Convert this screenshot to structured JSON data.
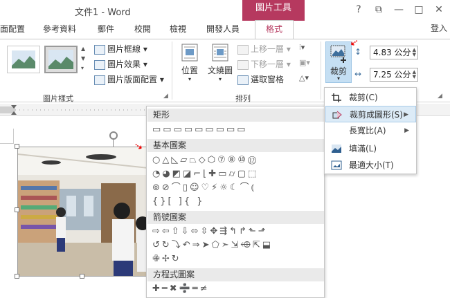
{
  "titlebar": {
    "doc_title": "文件1 - Word",
    "ctx_tools": "圖片工具",
    "help": "?",
    "restore_icon": "⧉",
    "minimize": "—",
    "maximize": "□",
    "close": "✕",
    "signin": "登入"
  },
  "tabs": [
    "面配置",
    "參考資料",
    "郵件",
    "校閱",
    "檢視",
    "開發人員"
  ],
  "active_tab": "格式",
  "ribbon": {
    "style_menu": [
      "圖片框線",
      "圖片效果",
      "圖片版面配置"
    ],
    "group_picture_styles": "圖片樣式",
    "position": "位置",
    "wrap_text": "文繞圖",
    "bring_forward": "上移一層",
    "send_backward": "下移一層",
    "selection_pane": "選取窗格",
    "group_arrange": "排列",
    "crop": "裁剪",
    "height": "4.83 公分",
    "width": "7.25 公分"
  },
  "shapes_gallery": {
    "categories": [
      "矩形",
      "基本圖案",
      "箭號圖案",
      "方程式圖案"
    ]
  },
  "crop_menu": {
    "items": [
      {
        "label": "裁剪(C)",
        "submenu": false
      },
      {
        "label": "裁剪成圖形(S)",
        "submenu": true
      },
      {
        "label": "長寬比(A)",
        "submenu": true
      },
      {
        "label": "填滿(L)",
        "submenu": false
      },
      {
        "label": "最適大小(T)",
        "submenu": false
      }
    ]
  },
  "colors": {
    "accent": "#b6395f",
    "crop_highlight": "#c5dff3",
    "menu_hover": "#dcebf7"
  }
}
